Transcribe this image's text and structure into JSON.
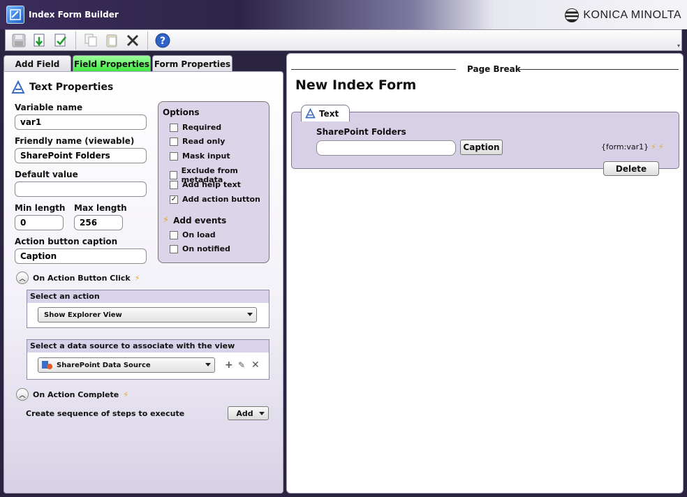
{
  "window": {
    "title": "Index Form Builder",
    "brand": "KONICA MINOLTA"
  },
  "tabs": [
    {
      "label": "Add Field"
    },
    {
      "label": "Field Properties"
    },
    {
      "label": "Form Properties"
    }
  ],
  "properties": {
    "title": "Text Properties",
    "variable_name_label": "Variable name",
    "variable_name_value": "var1",
    "friendly_name_label": "Friendly name (viewable)",
    "friendly_name_value": "SharePoint Folders",
    "default_value_label": "Default value",
    "default_value_value": "",
    "min_length_label": "Min length",
    "min_length_value": "0",
    "max_length_label": "Max length",
    "max_length_value": "256",
    "action_caption_label": "Action button caption",
    "action_caption_value": "Caption"
  },
  "options": {
    "title": "Options",
    "items": [
      {
        "label": "Required",
        "checked": false
      },
      {
        "label": "Read only",
        "checked": false
      },
      {
        "label": "Mask input",
        "checked": false
      },
      {
        "label": "Exclude from metadata",
        "checked": false
      },
      {
        "label": "Add help text",
        "checked": false
      },
      {
        "label": "Add action button",
        "checked": true
      }
    ],
    "events_title": "Add events",
    "events": [
      {
        "label": "On load",
        "checked": false
      },
      {
        "label": "On notified",
        "checked": false
      }
    ]
  },
  "action_click": {
    "title": "On Action Button Click",
    "select_action_header": "Select an action",
    "selected_action": "Show Explorer View",
    "datasource_header": "Select a data source to associate with the view",
    "selected_datasource": "SharePoint Data Source"
  },
  "action_complete": {
    "title": "On Action Complete",
    "sequence_label": "Create sequence of steps to execute",
    "add_label": "Add"
  },
  "canvas": {
    "page_break": "Page Break",
    "form_title": "New Index Form",
    "field_tab_label": "Text",
    "field_label": "SharePoint Folders",
    "field_value": "",
    "caption_button": "Caption",
    "form_ref": "{form:var1}",
    "delete_button": "Delete"
  },
  "colors": {
    "active_tab": "#3fe63f",
    "panel_accent": "#d8d0e6",
    "title_bg": "#2d2548"
  }
}
